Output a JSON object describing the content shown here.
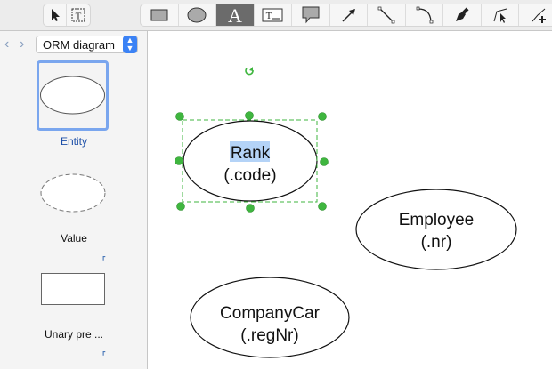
{
  "toolbar": {
    "select_tools": [
      {
        "icon": "pointer-icon"
      },
      {
        "icon": "text-box-select-icon"
      }
    ],
    "draw_tools": [
      {
        "icon": "rectangle-icon"
      },
      {
        "icon": "ellipse-icon"
      },
      {
        "icon": "text-icon",
        "label": "A",
        "selected": true
      },
      {
        "icon": "text-field-icon",
        "label": "T"
      },
      {
        "icon": "callout-icon"
      },
      {
        "icon": "arrow-icon"
      },
      {
        "icon": "line-icon"
      },
      {
        "icon": "arc-icon"
      },
      {
        "icon": "pen-icon"
      },
      {
        "icon": "edit-points-icon"
      },
      {
        "icon": "add-point-icon"
      }
    ]
  },
  "sidebar": {
    "library": "ORM diagram",
    "items": [
      {
        "label": "Entity",
        "selected": true
      },
      {
        "label": "Value"
      },
      {
        "label": "Unary pre ..."
      }
    ]
  },
  "canvas": {
    "shapes": [
      {
        "line1": "Rank",
        "line2": "(.code)",
        "selected": true
      },
      {
        "line1": "Employee",
        "line2": "(.nr)"
      },
      {
        "line1": "CompanyCar",
        "line2": "(.regNr)"
      }
    ],
    "accent": "#3fb63f",
    "highlight": "#b4d3f7"
  }
}
